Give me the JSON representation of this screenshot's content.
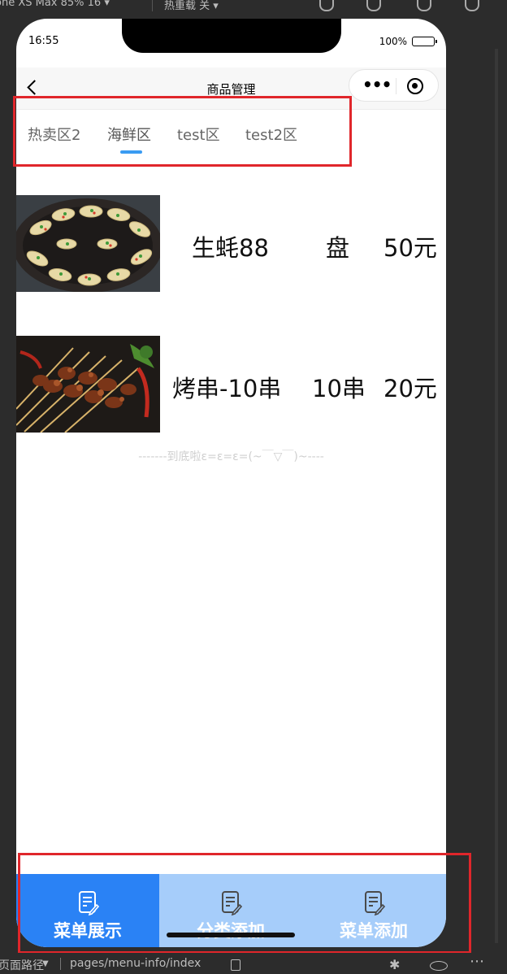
{
  "ide": {
    "device_label": "one XS Max 85% 16 ▾",
    "network_label": "热重载 关 ▾",
    "path_label": "页面路径",
    "page_path": "pages/menu-info/index"
  },
  "status": {
    "time": "16:55",
    "battery": "100%"
  },
  "navbar": {
    "title": "商品管理",
    "capsule_dots": "•••"
  },
  "tabs": [
    {
      "label": "热卖区2"
    },
    {
      "label": "海鲜区",
      "active": true
    },
    {
      "label": "test区"
    },
    {
      "label": "test2区"
    }
  ],
  "products": [
    {
      "name": "生蚝88",
      "unit": "盘",
      "price": "50元",
      "image": "grilled-oysters"
    },
    {
      "name": "烤串-10串",
      "unit": "10串",
      "price": "20元",
      "image": "grilled-skewers"
    }
  ],
  "bottom_hint": "-------到底啦ε=ε=ε=(~￣▽￣)~----",
  "tabbar": [
    {
      "label": "菜单展示",
      "icon": "menu-edit-icon",
      "selected": true
    },
    {
      "label": "分类添加",
      "icon": "menu-edit-icon",
      "selected": false
    },
    {
      "label": "菜单添加",
      "icon": "menu-edit-icon",
      "selected": false
    }
  ],
  "colors": {
    "tab_active_underline": "#3a9bf2",
    "tabbar_selected": "#2a82f5",
    "tabbar_bg": "#a6cdfa",
    "annotation_red": "#e0262b"
  }
}
